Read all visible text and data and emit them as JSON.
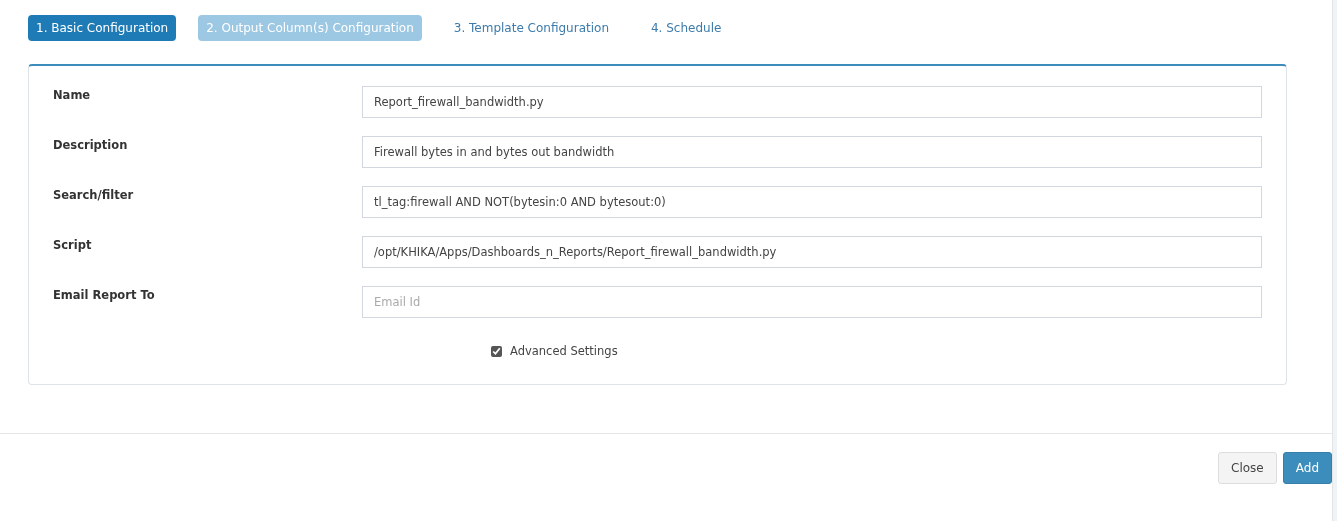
{
  "steps": [
    {
      "label": "1. Basic Configuration",
      "kind": "pill",
      "selected": true,
      "disabled": false
    },
    {
      "label": "2. Output Column(s) Configuration",
      "kind": "pill",
      "selected": false,
      "disabled": true
    },
    {
      "label": "3. Template Configuration",
      "kind": "link",
      "selected": false,
      "disabled": false
    },
    {
      "label": "4. Schedule",
      "kind": "link",
      "selected": false,
      "disabled": false
    }
  ],
  "form": {
    "fields": [
      {
        "label": "Name",
        "value": "Report_firewall_bandwidth.py"
      },
      {
        "label": "Description",
        "value": "Firewall bytes in and bytes out bandwidth"
      },
      {
        "label": "Search/filter",
        "value": "tl_tag:firewall AND NOT(bytesin:0 AND bytesout:0)"
      },
      {
        "label": "Script",
        "value": "/opt/KHIKA/Apps/Dashboards_n_Reports/Report_firewall_bandwidth.py"
      },
      {
        "label": "Email Report To",
        "placeholder": "Email Id"
      }
    ],
    "advanced": {
      "label": "Advanced Settings",
      "checked": true
    }
  },
  "footer": {
    "buttons": [
      {
        "label": "Close",
        "kind": "default"
      },
      {
        "label": "Add",
        "kind": "primary"
      }
    ]
  }
}
